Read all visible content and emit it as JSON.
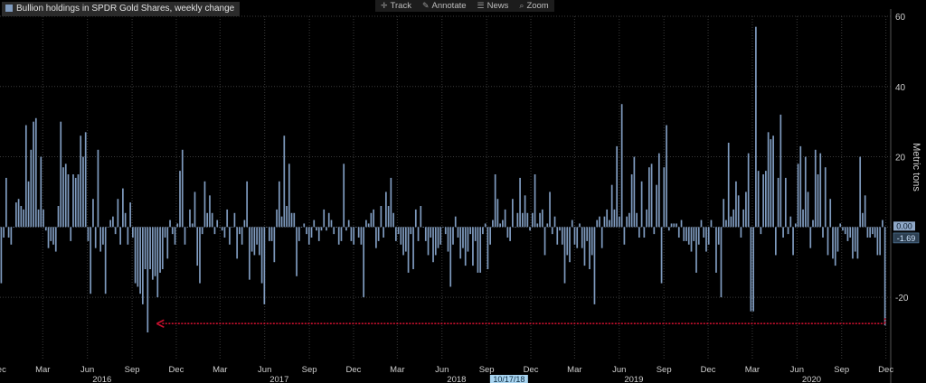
{
  "legend": {
    "label": "Bullion holdings in SPDR Gold Shares, weekly change",
    "swatch_color": "#7f9bbf"
  },
  "toolbar": [
    {
      "label": "Track",
      "icon": "crosshair-icon",
      "glyph": "✛"
    },
    {
      "label": "Annotate",
      "icon": "pencil-icon",
      "glyph": "✎"
    },
    {
      "label": "News",
      "icon": "news-icon",
      "glyph": "☰"
    },
    {
      "label": "Zoom",
      "icon": "magnifier-icon",
      "glyph": "⌕"
    }
  ],
  "colors": {
    "bar": "#7f9bbf",
    "grid": "#3a3a3a",
    "arrow": "#c8102e",
    "last_value_bg": "#2c3e50",
    "last_value_text": "#cfe6ff",
    "zero_label_bg": "#8fa8c8",
    "date_tag_bg": "#a8d4f0",
    "date_tag_text": "#0b2a40"
  },
  "chart_data": {
    "type": "bar",
    "title": "Bullion holdings in SPDR Gold Shares, weekly change",
    "ylabel": "Metric tons",
    "ylim": [
      -30,
      60
    ],
    "yticks": [
      -20,
      0,
      20,
      40,
      60
    ],
    "grid": true,
    "legend_position": "top-left",
    "x_start": "2015-12-04",
    "x_end": "2020-12-11",
    "month_ticks": [
      {
        "label": "Dec",
        "date": "2015-12-01"
      },
      {
        "label": "Mar",
        "date": "2016-03-01"
      },
      {
        "label": "Jun",
        "date": "2016-06-01"
      },
      {
        "label": "Sep",
        "date": "2016-09-01"
      },
      {
        "label": "Dec",
        "date": "2016-12-01"
      },
      {
        "label": "Mar",
        "date": "2017-03-01"
      },
      {
        "label": "Jun",
        "date": "2017-06-01"
      },
      {
        "label": "Sep",
        "date": "2017-09-01"
      },
      {
        "label": "Dec",
        "date": "2017-12-01"
      },
      {
        "label": "Mar",
        "date": "2018-03-01"
      },
      {
        "label": "Jun",
        "date": "2018-06-01"
      },
      {
        "label": "Sep",
        "date": "2018-09-01"
      },
      {
        "label": "Dec",
        "date": "2018-12-01"
      },
      {
        "label": "Mar",
        "date": "2019-03-01"
      },
      {
        "label": "Jun",
        "date": "2019-06-01"
      },
      {
        "label": "Sep",
        "date": "2019-09-01"
      },
      {
        "label": "Dec",
        "date": "2019-12-01"
      },
      {
        "label": "Mar",
        "date": "2020-03-01"
      },
      {
        "label": "Jun",
        "date": "2020-06-01"
      },
      {
        "label": "Sep",
        "date": "2020-09-01"
      },
      {
        "label": "Dec",
        "date": "2020-12-01"
      }
    ],
    "year_labels": [
      {
        "label": "2016",
        "date": "2016-07-01"
      },
      {
        "label": "2017",
        "date": "2017-07-01"
      },
      {
        "label": "2018",
        "date": "2018-07-01"
      },
      {
        "label": "2019",
        "date": "2019-07-01"
      },
      {
        "label": "2020",
        "date": "2020-07-01"
      }
    ],
    "date_tag": {
      "label": "10/17/18",
      "date": "2018-10-17"
    },
    "last_value": {
      "label": "-1.69",
      "value": -1.69
    },
    "zero_label": {
      "label": "0.00",
      "value": 0
    },
    "values": [
      -16,
      -3,
      14,
      -3,
      -5,
      0,
      7,
      8,
      6,
      5,
      29,
      13,
      22,
      30,
      31,
      5,
      20,
      5,
      -1,
      -6,
      -4,
      -5,
      -7,
      6,
      30,
      17,
      18,
      15,
      -4,
      15,
      14,
      15,
      26,
      20,
      27,
      -4,
      -19,
      8,
      -6,
      22,
      -7,
      -5,
      -19,
      0,
      2,
      3,
      -2,
      8,
      -5,
      11,
      4,
      -5,
      7,
      -3,
      -16,
      -17,
      -19,
      -22,
      -12,
      -30,
      -12,
      -15,
      -14,
      -20,
      -13,
      -12,
      -3,
      -9,
      2,
      -2,
      -5,
      1,
      16,
      22,
      -5,
      0,
      5,
      1,
      10,
      -11,
      -16,
      -2,
      13,
      4,
      9,
      4,
      -2,
      2,
      0,
      -1,
      -3,
      5,
      -5,
      0,
      4,
      -9,
      -2,
      -5,
      2,
      13,
      -15,
      -7,
      -8,
      -5,
      -8,
      -16,
      -22,
      0,
      -4,
      -4,
      -10,
      5,
      13,
      3,
      26,
      6,
      18,
      4,
      4,
      -14,
      -4,
      0,
      1,
      -2,
      -5,
      -3,
      2,
      -1,
      -4,
      -1,
      5,
      -1,
      4,
      2,
      -2,
      0,
      -5,
      -4,
      18,
      -1,
      2,
      -4,
      -5,
      0,
      -3,
      -5,
      -20,
      2,
      1,
      4,
      5,
      -6,
      -4,
      6,
      -3,
      10,
      6,
      14,
      4,
      -4,
      -2,
      -5,
      -8,
      -7,
      -13,
      -2,
      -12,
      5,
      -4,
      6,
      0,
      -4,
      -8,
      -3,
      -10,
      -8,
      -6,
      -5,
      0,
      -2,
      -7,
      -17,
      -5,
      3,
      -3,
      -9,
      -6,
      -11,
      -7,
      -2,
      -11,
      -4,
      -13,
      -13,
      -2,
      1,
      -12,
      -5,
      2,
      15,
      8,
      1,
      2,
      5,
      -3,
      -4,
      8,
      0,
      4,
      14,
      4,
      9,
      4,
      -1,
      4,
      15,
      1,
      4,
      5,
      -8,
      1,
      10,
      -2,
      3,
      -5,
      -1,
      -5,
      -16,
      -8,
      -10,
      2,
      -5,
      -6,
      1,
      -6,
      -11,
      -4,
      -12,
      -8,
      -22,
      2,
      3,
      -6,
      3,
      5,
      2,
      12,
      5,
      23,
      3,
      35,
      -5,
      3,
      4,
      15,
      20,
      4,
      -3,
      13,
      -3,
      5,
      17,
      18,
      -2,
      12,
      21,
      -16,
      17,
      29,
      -1,
      1,
      1,
      1,
      -3,
      2,
      -4,
      -4,
      -5,
      -7,
      -4,
      -13,
      -5,
      2,
      -3,
      -7,
      -5,
      2,
      0,
      -13,
      -5,
      -20,
      8,
      2,
      24,
      3,
      5,
      13,
      9,
      -3,
      5,
      10,
      21,
      -24,
      -24,
      57,
      16,
      -2,
      15,
      16,
      27,
      25,
      26,
      -8,
      14,
      32,
      -3,
      14,
      -2,
      3,
      -8,
      1,
      18,
      23,
      5,
      20,
      10,
      -6,
      2,
      22,
      15,
      21,
      -3,
      17,
      -8,
      8,
      -9,
      -11,
      -7,
      1,
      -1,
      -2,
      -4,
      -3,
      -9,
      -7,
      -9,
      20,
      4,
      9,
      -3,
      -3,
      -2,
      -3,
      -8,
      -8,
      2,
      -28
    ]
  }
}
